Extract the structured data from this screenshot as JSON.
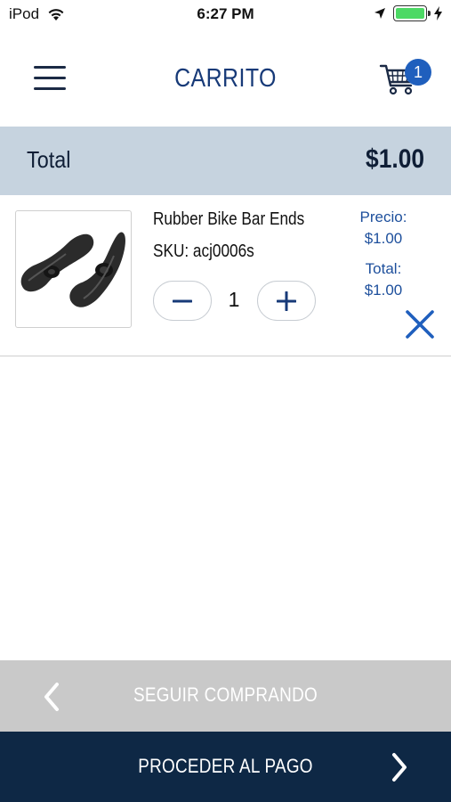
{
  "status_bar": {
    "carrier": "iPod",
    "time": "6:27 PM",
    "battery_level": 1.0
  },
  "header": {
    "title": "CARRITO",
    "cart_count": "1"
  },
  "total": {
    "label": "Total",
    "value": "$1.00"
  },
  "cart_items": [
    {
      "name": "Rubber Bike Bar Ends",
      "sku": "SKU: acj0006s",
      "quantity": "1",
      "price_label": "Precio:",
      "price": "$1.00",
      "total_label": "Total:",
      "total": "$1.00"
    }
  ],
  "footer": {
    "continue_label": "SEGUIR COMPRANDO",
    "checkout_label": "PROCEDER AL PAGO"
  },
  "colors": {
    "brand_blue": "#173a78",
    "accent_blue": "#1f5fbd",
    "total_bar_bg": "#c6d3df",
    "continue_bg": "#c9c9c9",
    "checkout_bg": "#0e2845",
    "battery_green": "#4cd964"
  },
  "icons": {
    "menu": "hamburger-menu-icon",
    "cart": "shopping-cart-icon",
    "minus": "minus-icon",
    "plus": "plus-icon",
    "remove": "close-icon",
    "back": "chevron-left-icon",
    "forward": "chevron-right-icon"
  }
}
